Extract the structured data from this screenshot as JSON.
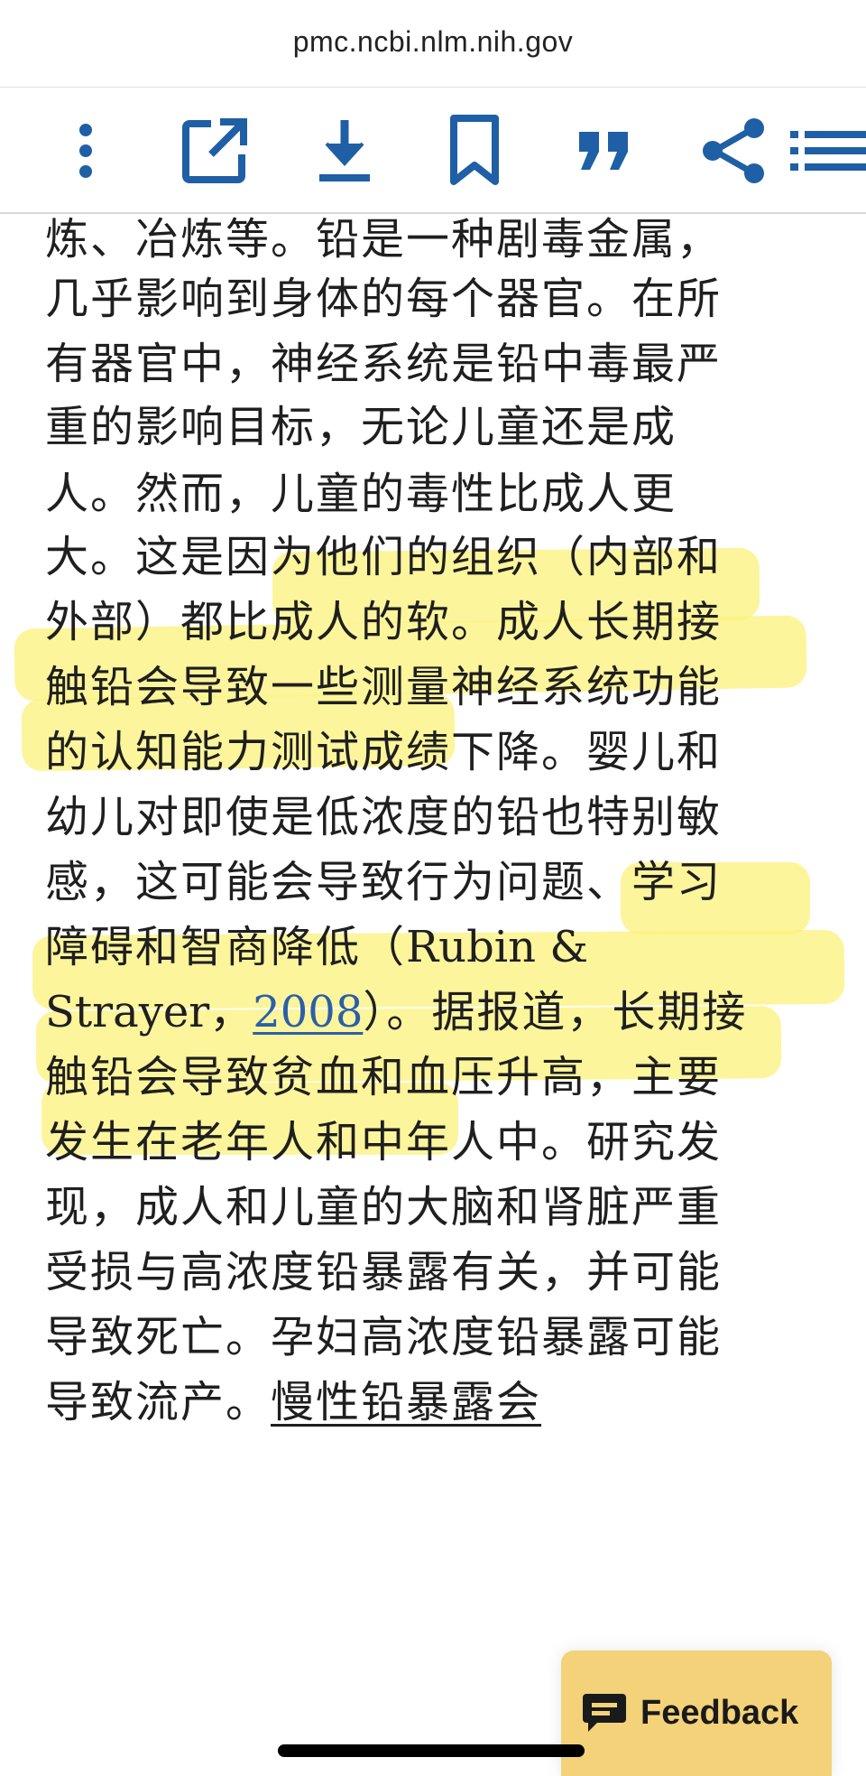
{
  "browser": {
    "url": "pmc.ncbi.nlm.nih.gov"
  },
  "toolbar": {
    "icons": [
      "more-vertical-icon",
      "open-external-icon",
      "download-icon",
      "bookmark-icon",
      "cite-quote-icon",
      "share-icon",
      "list-icon"
    ],
    "accent_color": "#1f5fa5"
  },
  "article": {
    "lines": [
      "炼、冶炼等。铅是一种剧毒金属，",
      "几乎影响到身体的每个器官。在所",
      "有器官中，神经系统是铅中毒最严",
      "重的影响目标，无论儿童还是成",
      "人。然而，儿童的毒性比成人更",
      "大。这是因为他们的组织（内部和",
      "外部）都比成人的软。成人长期接",
      "触铅会导致一些测量神经系统功能",
      "的认知能力测试成绩下降。婴儿和",
      "幼儿对即使是低浓度的铅也特别敏",
      "感，这可能会导致行为问题、学习",
      "障碍和智商降低（Rubin &",
      "Strayer，2008）。据报道，长期接",
      "触铅会导致贫血和血压升高，主要",
      "发生在老年人和中年人中。研究发",
      "现，成人和儿童的大脑和肾脏严重",
      "受损与高浓度铅暴露有关，并可能",
      "导致死亡。孕妇高浓度铅暴露可能",
      "导致流产。慢性铅暴露会"
    ],
    "line12_pre": "障碍和智商降低（",
    "line12_latin": "Rubin &",
    "line13_pre": "Strayer，",
    "citation_year": "2008",
    "line13_post": "）。据报道，长期接",
    "line19_pre": "导致流产。",
    "line19_underlined": "慢性铅暴露会",
    "highlight_color": "#fbf27a"
  },
  "feedback": {
    "label": "Feedback",
    "icon": "chat-icon",
    "color": "#f3d27a"
  }
}
